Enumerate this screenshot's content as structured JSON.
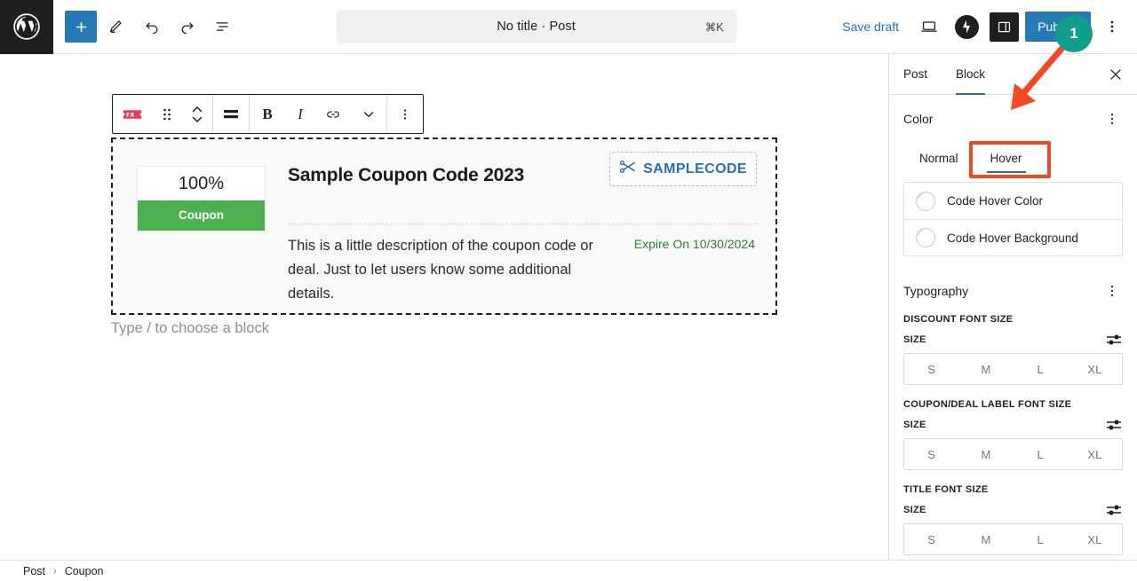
{
  "topbar": {
    "logo_icon": "wordpress-logo-icon",
    "add_block_icon": "plus-icon",
    "tools_icon": "pencil-icon",
    "undo_icon": "undo-arrow-icon",
    "redo_icon": "redo-arrow-icon",
    "list_view_icon": "document-overview-icon",
    "title": "No title · Post",
    "shortcut": "⌘K",
    "save_draft_label": "Save draft",
    "preview_icon": "laptop-preview-icon",
    "jetpack_icon": "jetpack-circle-icon",
    "settings_sidebar_icon": "settings-panel-icon",
    "publish_label": "Publish",
    "options_icon": "kebab-menu-icon"
  },
  "block_toolbar": {
    "block_type_icon": "coupon-block-icon",
    "drag_icon": "drag-handle-icon",
    "move_icon": "move-up-down-icon",
    "align_icon": "align-center-icon",
    "bold_label": "B",
    "italic_label": "I",
    "link_icon": "link-icon",
    "more_rich_text_icon": "chevron-down-icon",
    "options_icon": "kebab-menu-icon"
  },
  "coupon_block": {
    "discount_percent": "100%",
    "deal_label": "Coupon",
    "title": "Sample Coupon Code 2023",
    "code": "SAMPLECODE",
    "code_icon": "scissors-icon",
    "description": "This is a little description of the coupon code or deal. Just to let users know some additional details.",
    "expire_text": "Expire On 10/30/2024",
    "colors": {
      "deal_label_bg": "#4caf50",
      "code_text": "#2f6fad",
      "expire_text": "#2e7d32"
    }
  },
  "empty_paragraph_placeholder": "Type / to choose a block",
  "sidebar": {
    "tabs": [
      {
        "label": "Post",
        "active": false
      },
      {
        "label": "Block",
        "active": true
      }
    ],
    "close_icon": "close-icon",
    "color_panel": {
      "title": "Color",
      "options_icon": "kebab-menu-icon",
      "state_tabs": [
        {
          "label": "Normal",
          "active": false
        },
        {
          "label": "Hover",
          "active": true
        }
      ],
      "rows": [
        {
          "label": "Code Hover Color",
          "swatch_icon": "empty-color-swatch-icon"
        },
        {
          "label": "Code Hover Background",
          "swatch_icon": "empty-color-swatch-icon"
        }
      ]
    },
    "typography_panel": {
      "title": "Typography",
      "options_icon": "kebab-menu-icon",
      "groups": [
        {
          "label": "DISCOUNT FONT SIZE",
          "size_label": "SIZE",
          "slider_icon": "sliders-icon",
          "sizes": [
            "S",
            "M",
            "L",
            "XL"
          ]
        },
        {
          "label": "COUPON/DEAL LABEL FONT SIZE",
          "size_label": "SIZE",
          "slider_icon": "sliders-icon",
          "sizes": [
            "S",
            "M",
            "L",
            "XL"
          ]
        },
        {
          "label": "TITLE FONT SIZE",
          "size_label": "SIZE",
          "slider_icon": "sliders-icon",
          "sizes": [
            "S",
            "M",
            "L",
            "XL"
          ]
        }
      ]
    }
  },
  "annotation": {
    "badge_number": "1",
    "badge_color": "#0f9d8c",
    "arrow_color": "#f04a25",
    "highlight_color": "#f04a25"
  },
  "bottombar": {
    "breadcrumb": [
      "Post",
      "Coupon"
    ],
    "separator": "›"
  }
}
